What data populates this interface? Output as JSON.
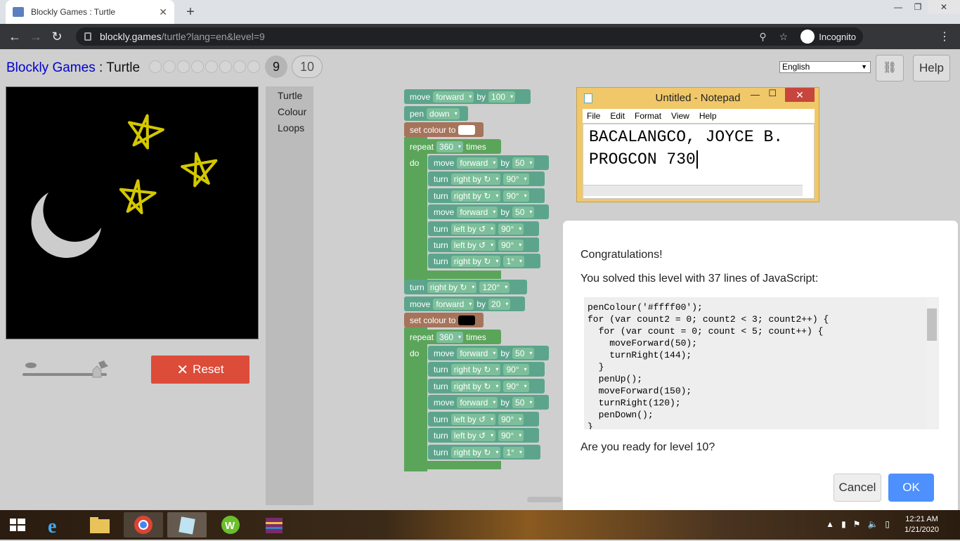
{
  "browser": {
    "tab_title": "Blockly Games : Turtle",
    "url_host": "blockly.games",
    "url_path": "/turtle?lang=en&level=9",
    "incognito": "Incognito"
  },
  "app": {
    "brand": "Blockly Games",
    "sep": " : ",
    "name": "Turtle",
    "level_current": "9",
    "level_next": "10",
    "language": "English",
    "help": "Help",
    "reset": "Reset"
  },
  "toolbox": [
    "Turtle",
    "Colour",
    "Loops"
  ],
  "blocks": {
    "move": "move",
    "forward": "forward",
    "by": "by",
    "pen": "pen",
    "down": "down",
    "set_colour": "set colour to",
    "repeat": "repeat",
    "times": "times",
    "do": "do",
    "turn": "turn",
    "right_by": "right by ↻",
    "left_by": "left by ↺",
    "v100": "100",
    "v360": "360",
    "v50": "50",
    "v90": "90°",
    "v1": "1°",
    "v120": "120°",
    "v20": "20"
  },
  "notepad": {
    "title": "Untitled - Notepad",
    "menu": [
      "File",
      "Edit",
      "Format",
      "View",
      "Help"
    ],
    "line1": "BACALANGCO, JOYCE B.",
    "line2": "PROGCON 730"
  },
  "dialog": {
    "congrats": "Congratulations!",
    "solved": "You solved this level with 37 lines of JavaScript:",
    "code": "penColour('#ffff00');\nfor (var count2 = 0; count2 < 3; count2++) {\n  for (var count = 0; count < 5; count++) {\n    moveForward(50);\n    turnRight(144);\n  }\n  penUp();\n  moveForward(150);\n  turnRight(120);\n  penDown();\n}",
    "question": "Are you ready for level 10?",
    "cancel": "Cancel",
    "ok": "OK"
  },
  "taskbar": {
    "time": "12:21 AM",
    "date": "1/21/2020"
  },
  "colors": {
    "star": "#d4c800",
    "moon": "#cccccc",
    "reset": "#dd4b39",
    "ok": "#4d90fe",
    "block_green": "#5ba55b",
    "block_teal": "#5ca58c",
    "block_brown": "#a5745b"
  }
}
